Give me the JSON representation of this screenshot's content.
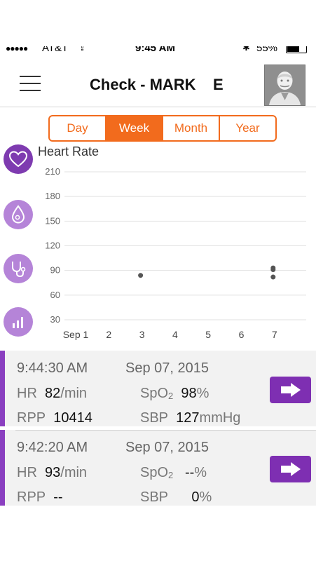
{
  "status_bar": {
    "signal": "●●●●●",
    "carrier": "AT&T",
    "time": "9:45 AM",
    "battery": "55%"
  },
  "navbar": {
    "title": "Check - MARK    E"
  },
  "tabs": [
    {
      "label": "Day",
      "active": false
    },
    {
      "label": "Week",
      "active": true
    },
    {
      "label": "Month",
      "active": false
    },
    {
      "label": "Year",
      "active": false
    }
  ],
  "side_icons": [
    "heart-icon",
    "oxygen-drop-icon",
    "stethoscope-icon",
    "bar-chart-icon"
  ],
  "chart_data": {
    "type": "scatter",
    "title": "Heart Rate",
    "categories": [
      "Sep 1",
      "2",
      "3",
      "4",
      "5",
      "6",
      "7"
    ],
    "y_ticks": [
      210,
      180,
      150,
      120,
      90,
      60,
      30
    ],
    "ylim": [
      30,
      210
    ],
    "grid": true,
    "points": [
      {
        "x": "3",
        "y": 84
      },
      {
        "x": "7",
        "y": 93
      },
      {
        "x": "7",
        "y": 91
      },
      {
        "x": "7",
        "y": 82
      }
    ],
    "point_color": "#555555"
  },
  "records": [
    {
      "time": "9:44:30 AM",
      "date": "Sep 07, 2015",
      "hr_label": "HR",
      "hr_value": "82",
      "hr_unit": "/min",
      "spo2_label": "SpO",
      "spo2_sub": "2",
      "spo2_value": "98",
      "spo2_unit": "%",
      "rpp_label": "RPP",
      "rpp_value": "10414",
      "sbp_label": "SBP",
      "sbp_value": "127",
      "sbp_unit": "mmHg"
    },
    {
      "time": "9:42:20 AM",
      "date": "Sep 07, 2015",
      "hr_label": "HR",
      "hr_value": "93",
      "hr_unit": "/min",
      "spo2_label": "SpO",
      "spo2_sub": "2",
      "spo2_value": "--",
      "spo2_unit": "%",
      "rpp_label": "RPP",
      "rpp_value": "--",
      "sbp_label": "SBP",
      "sbp_value": "0",
      "sbp_unit": "%"
    }
  ],
  "colors": {
    "accent_orange": "#f26b1d",
    "accent_purple": "#7e2fb2",
    "light_purple": "#b584d8"
  }
}
